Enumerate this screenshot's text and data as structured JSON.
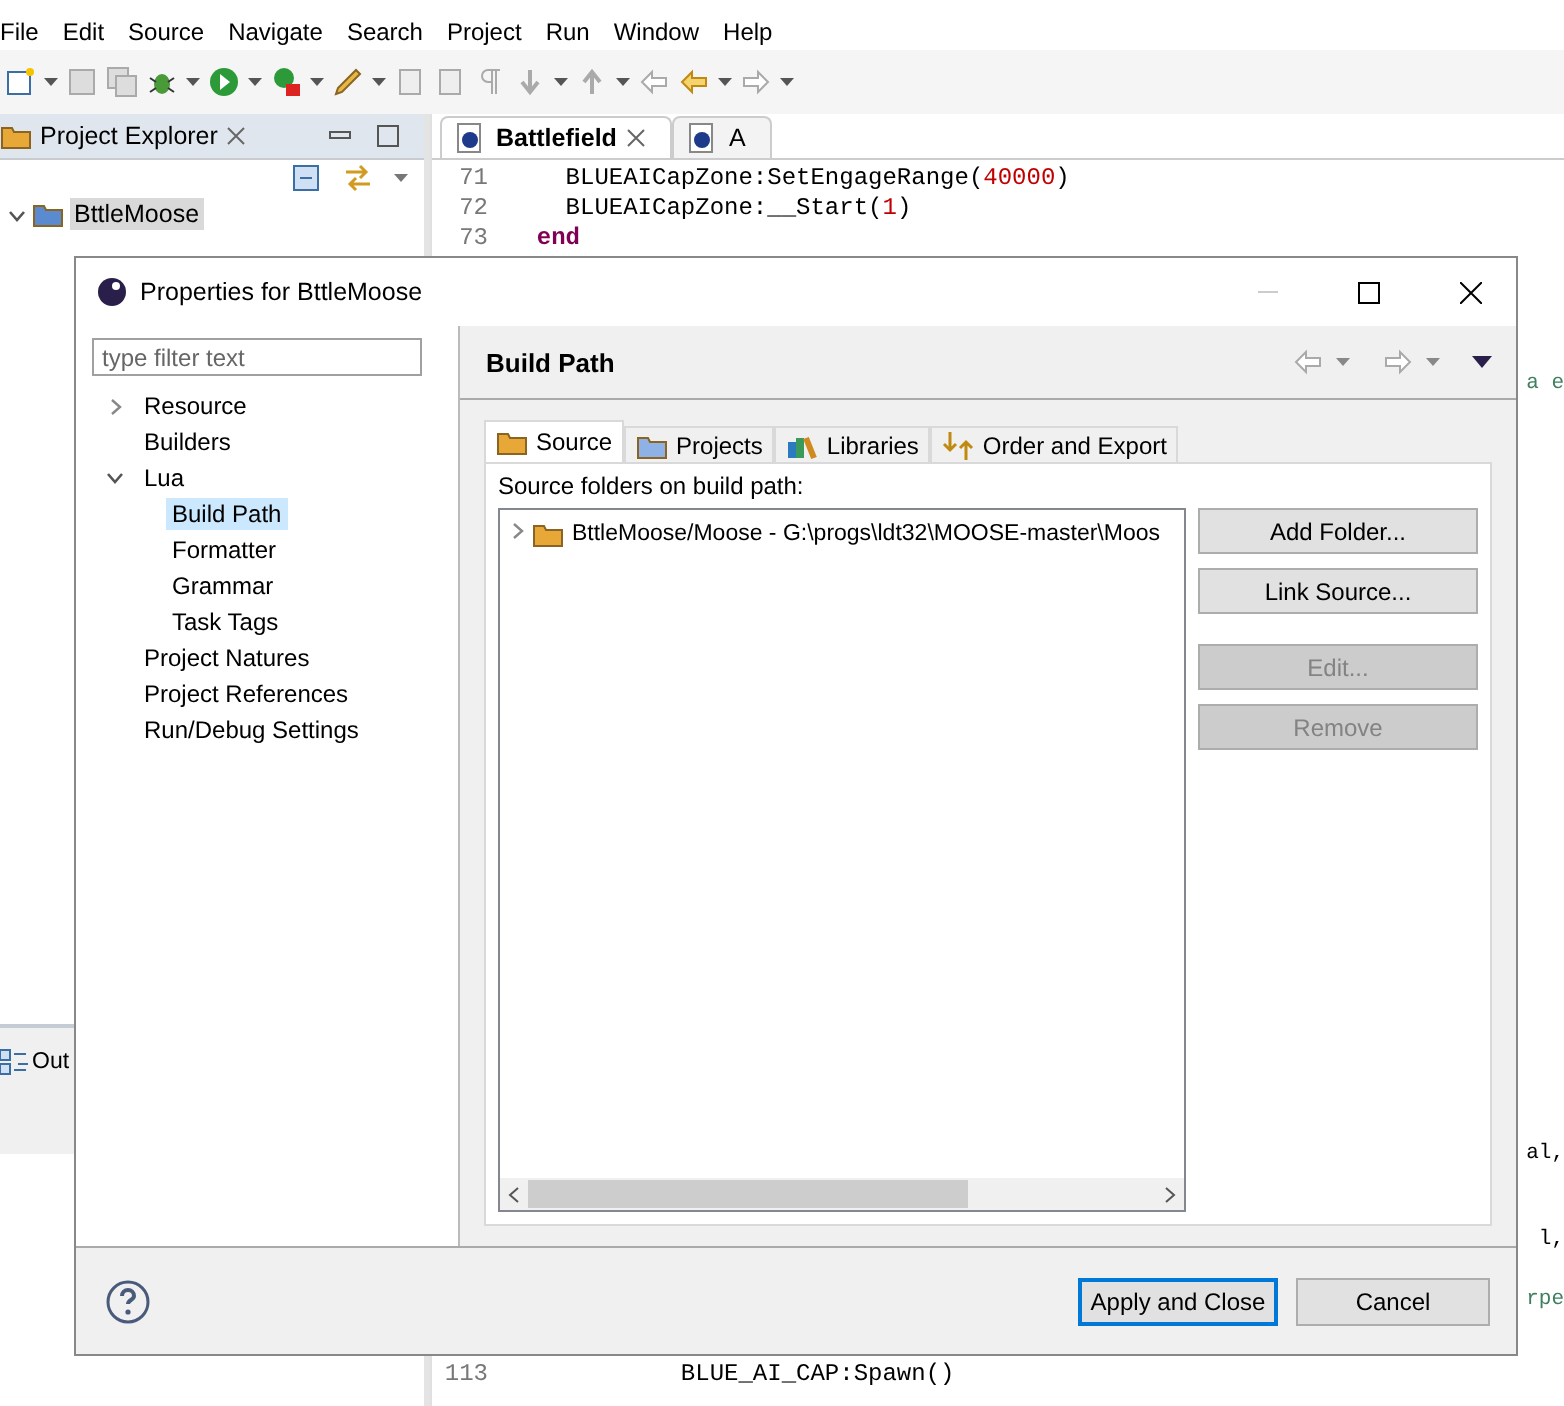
{
  "menu": [
    "File",
    "Edit",
    "Source",
    "Navigate",
    "Search",
    "Project",
    "Run",
    "Window",
    "Help"
  ],
  "explorer": {
    "title": "Project Explorer",
    "items": [
      {
        "label": "BttleMoose",
        "selected": true,
        "expanded": true
      }
    ]
  },
  "outline": {
    "title": "Out"
  },
  "editor": {
    "tabs": [
      {
        "label": "Battlefield",
        "selected": true
      },
      {
        "label": "A",
        "selected": false
      }
    ],
    "top_lines": [
      {
        "number": "71",
        "tokens": [
          {
            "kind": "plain",
            "text": "    BLUEAICapZone:SetEngageRange("
          },
          {
            "kind": "number",
            "text": "40000"
          },
          {
            "kind": "plain",
            "text": ")"
          }
        ]
      },
      {
        "number": "72",
        "tokens": [
          {
            "kind": "plain",
            "text": "    BLUEAICapZone:__Start("
          },
          {
            "kind": "number",
            "text": "1"
          },
          {
            "kind": "plain",
            "text": ")"
          }
        ]
      },
      {
        "number": "73",
        "tokens": [
          {
            "kind": "keyword",
            "text": "  end"
          }
        ]
      }
    ],
    "fragments": [
      {
        "text": "a e",
        "kind": "comment"
      },
      {
        "text": "al,",
        "kind": "plain"
      },
      {
        "text": "l,",
        "kind": "plain"
      },
      {
        "text": "rpe",
        "kind": "comment"
      }
    ],
    "bottom_lines": [
      {
        "number": "113",
        "tokens": [
          {
            "kind": "plain",
            "text": "            BLUE_AI_CAP:Spawn()"
          }
        ]
      }
    ]
  },
  "dialog": {
    "title": "Properties for BttleMoose",
    "filter": {
      "placeholder": "type filter text"
    },
    "tree": [
      {
        "label": "Resource",
        "selected": false,
        "expandable": true,
        "expanded": false
      },
      {
        "label": "Builders",
        "selected": false,
        "expandable": false
      },
      {
        "label": "Lua",
        "selected": false,
        "expandable": true,
        "expanded": true,
        "children": [
          {
            "label": "Build Path",
            "selected": true
          },
          {
            "label": "Formatter",
            "selected": false
          },
          {
            "label": "Grammar",
            "selected": false
          },
          {
            "label": "Task Tags",
            "selected": false
          }
        ]
      },
      {
        "label": "Project Natures",
        "selected": false,
        "expandable": false
      },
      {
        "label": "Project References",
        "selected": false,
        "expandable": false
      },
      {
        "label": "Run/Debug Settings",
        "selected": false,
        "expandable": false
      }
    ],
    "page_title": "Build Path",
    "tabs": [
      {
        "label": "Source",
        "kind": "source",
        "selected": true
      },
      {
        "label": "Projects",
        "kind": "projects",
        "selected": false
      },
      {
        "label": "Libraries",
        "kind": "libraries",
        "selected": false
      },
      {
        "label": "Order and Export",
        "kind": "order",
        "selected": false
      }
    ],
    "list_label": "Source folders on build path:",
    "entries": [
      {
        "label": "BttleMoose/Moose - G:\\progs\\ldt32\\MOOSE-master\\Moos",
        "expanded": false
      }
    ],
    "side_buttons": [
      {
        "label": "Add Folder...",
        "disabled": false
      },
      {
        "label": "Link Source...",
        "disabled": false
      },
      {
        "label": "Edit...",
        "disabled": true
      },
      {
        "label": "Remove",
        "disabled": true
      }
    ],
    "footer_buttons": [
      {
        "label": "Apply and Close",
        "default": true
      },
      {
        "label": "Cancel",
        "default": false
      }
    ]
  }
}
